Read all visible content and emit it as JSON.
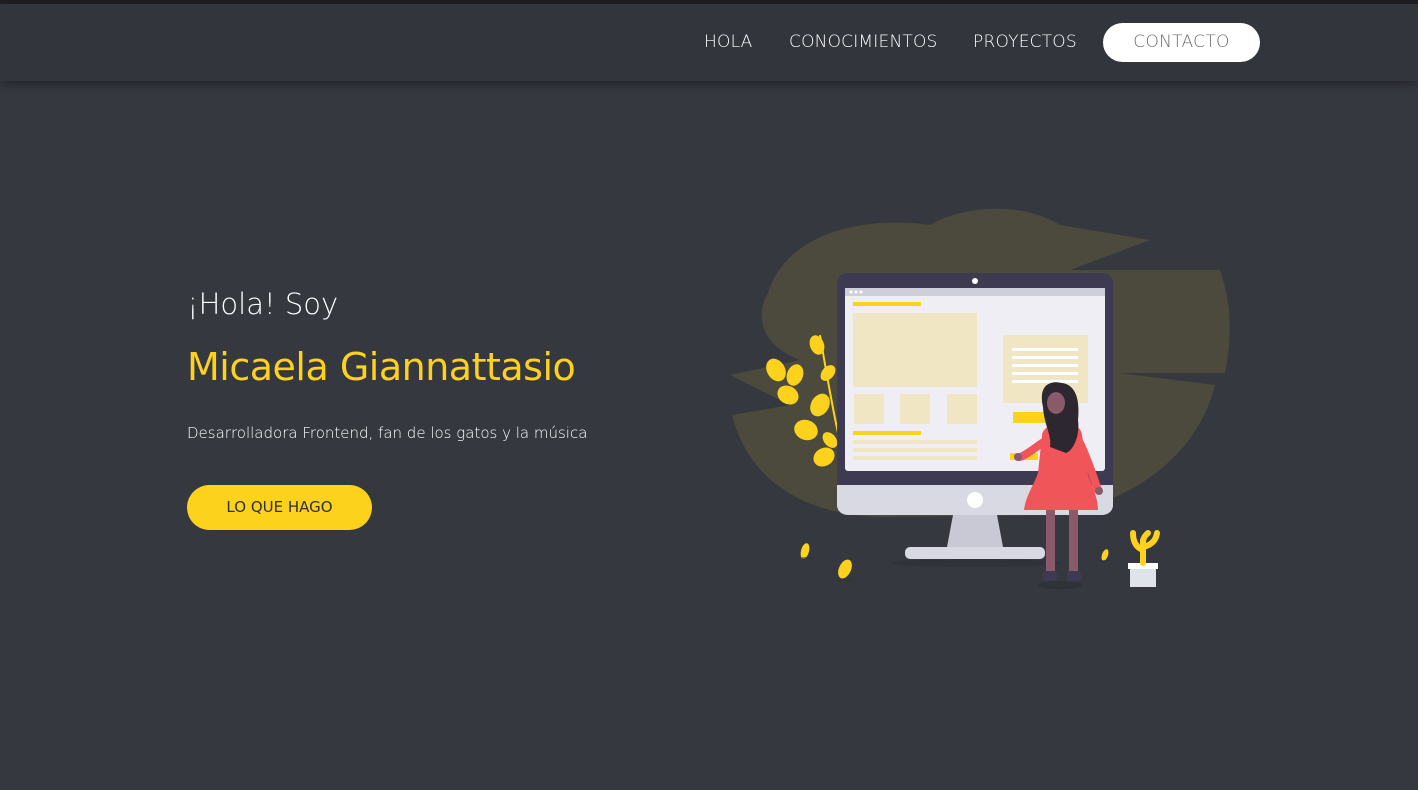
{
  "nav": {
    "items": [
      {
        "label": "HOLA"
      },
      {
        "label": "CONOCIMIENTOS"
      },
      {
        "label": "PROYECTOS"
      }
    ],
    "cta_label": "CONTACTO"
  },
  "hero": {
    "greeting": "¡Hola! Soy",
    "name": "Micaela Giannattasio",
    "subtitle": "Desarrolladora Frontend, fan de los gatos y la música",
    "button_label": "LO QUE HAGO"
  },
  "colors": {
    "background": "#363840",
    "navbar": "#33353c",
    "accent": "#fcd21d",
    "figure_dress": "#f0555a"
  },
  "illustration": {
    "icon": "woman-at-computer-illustration"
  }
}
